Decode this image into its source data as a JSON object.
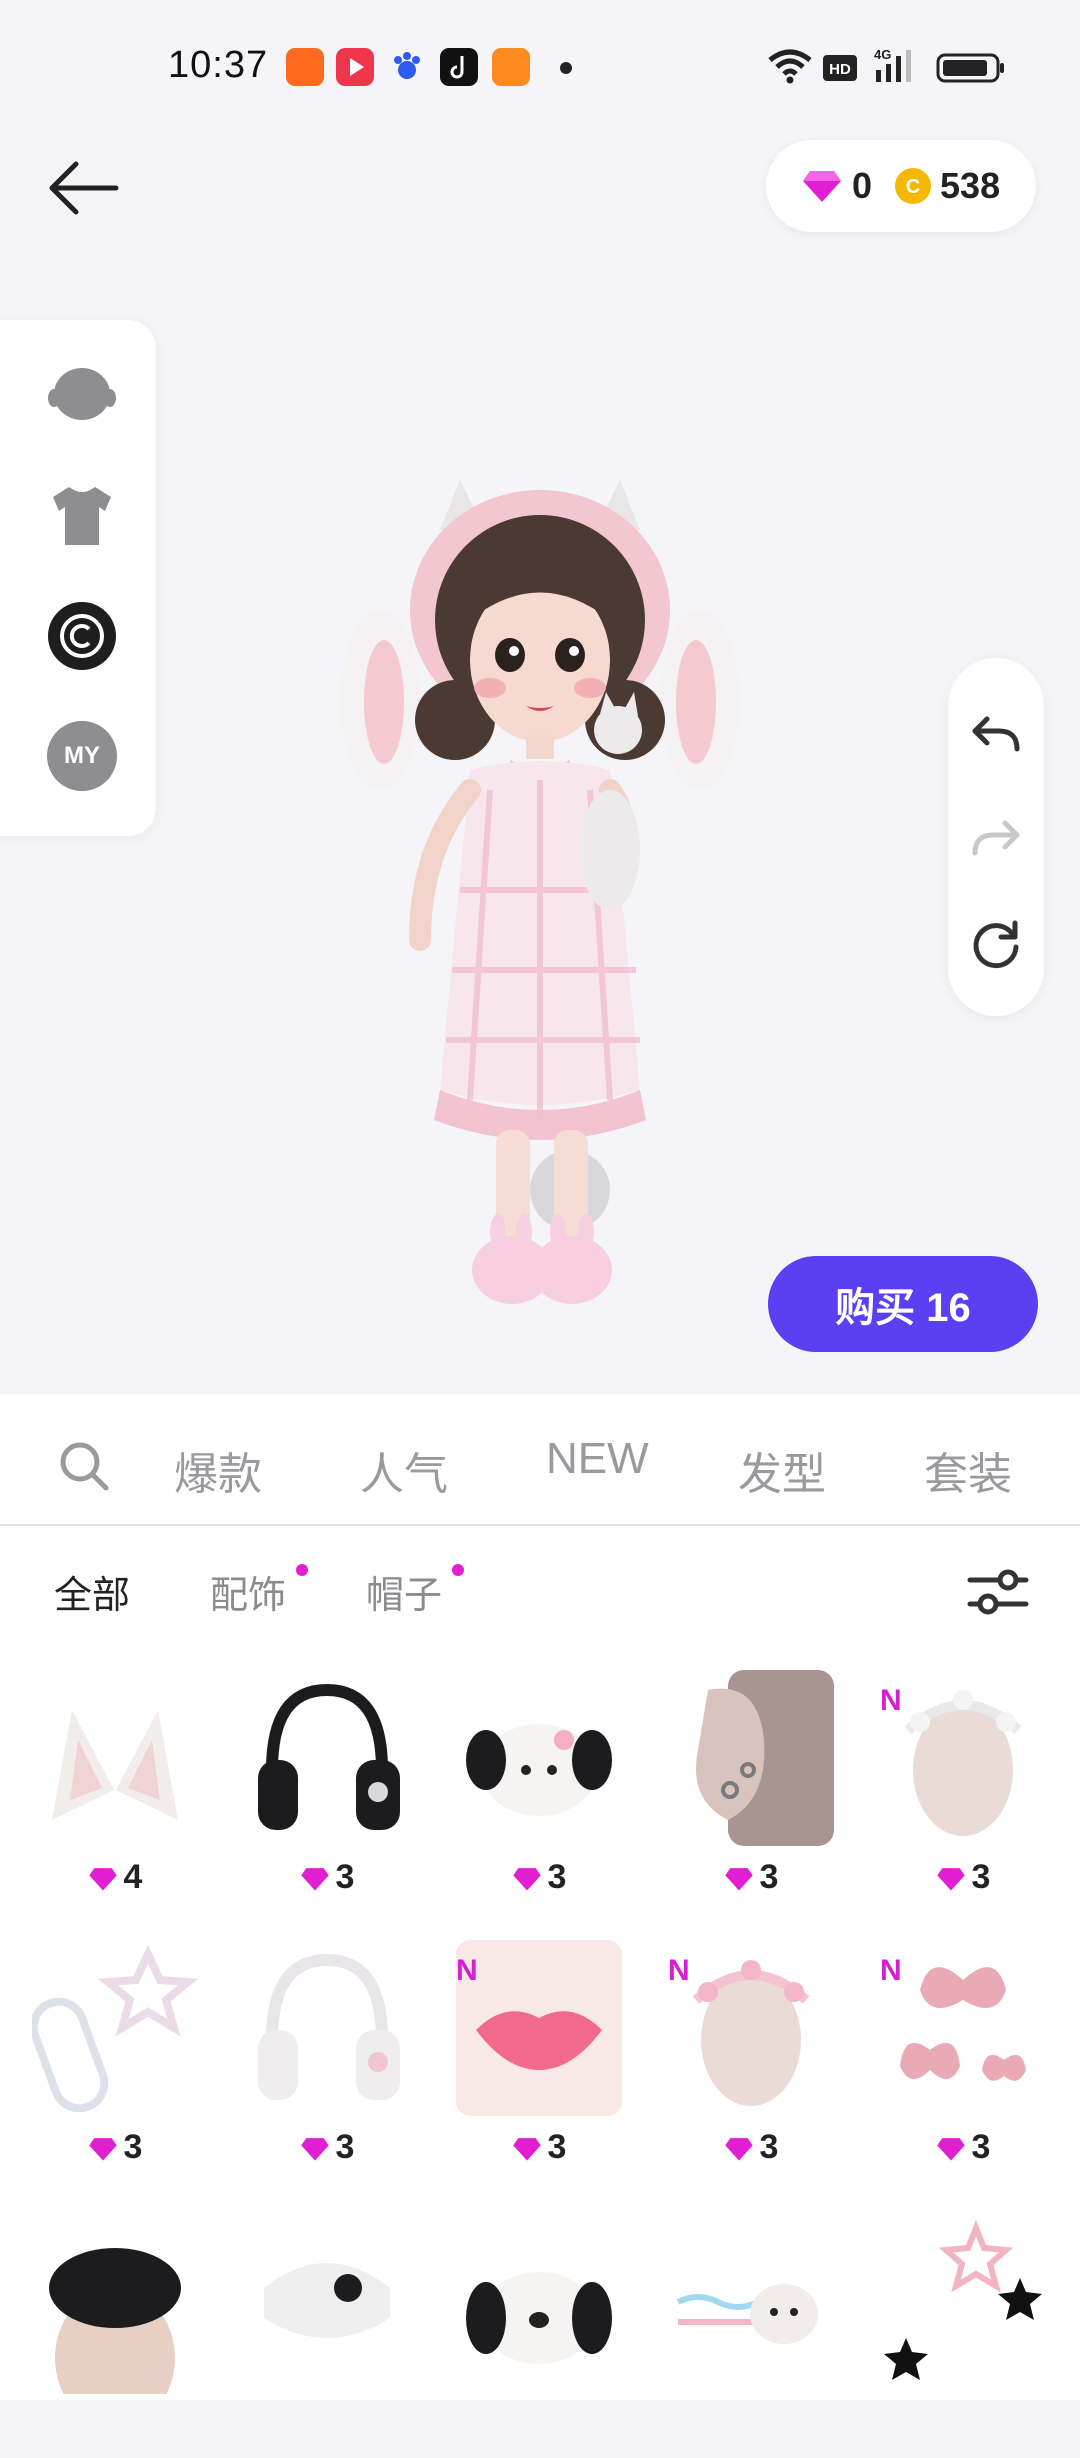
{
  "status_bar": {
    "time": "10:37"
  },
  "header": {
    "diamonds": "0",
    "coins": "538"
  },
  "side_panel": {
    "my_label": "MY"
  },
  "actions": {
    "buy_label": "购买 16"
  },
  "tabs": [
    "爆款",
    "人气",
    "NEW",
    "发型",
    "套装"
  ],
  "subtabs": [
    "全部",
    "配饰",
    "帽子"
  ],
  "items": [
    {
      "price": "4"
    },
    {
      "price": "3"
    },
    {
      "price": "3"
    },
    {
      "price": "3"
    },
    {
      "price": "3",
      "badge": "N"
    },
    {
      "price": "3"
    },
    {
      "price": "3"
    },
    {
      "price": "3",
      "badge": "N"
    },
    {
      "price": "3",
      "badge": "N"
    },
    {
      "price": "3",
      "badge": "N"
    }
  ],
  "colors": {
    "accent": "#5b3ff2",
    "gem": "#e11ed1",
    "coin": "#f5b800"
  }
}
